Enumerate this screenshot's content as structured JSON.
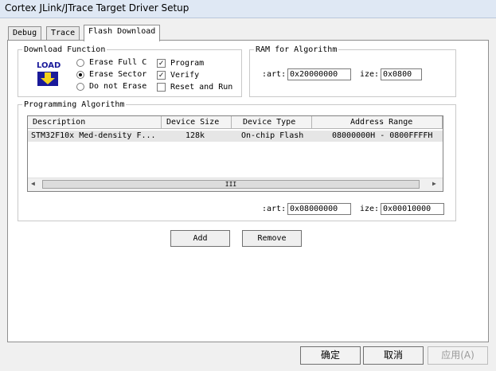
{
  "window": {
    "title": "Cortex JLink/JTrace Target Driver Setup"
  },
  "tabs": [
    {
      "label": "Debug"
    },
    {
      "label": "Trace"
    },
    {
      "label": "Flash Download"
    }
  ],
  "download_function": {
    "legend": "Download Function",
    "icon_text": "LOAD",
    "options": [
      {
        "label": "Erase Full C",
        "selected": false
      },
      {
        "label": "Erase Sector",
        "selected": true
      },
      {
        "label": "Do not Erase",
        "selected": false
      }
    ],
    "checks": [
      {
        "label": "Program",
        "checked": true
      },
      {
        "label": "Verify",
        "checked": true
      },
      {
        "label": "Reset and Run",
        "checked": false
      }
    ]
  },
  "ram": {
    "legend": "RAM for Algorithm",
    "start_label": ":art:",
    "start_value": "0x20000000",
    "size_label": "ize:",
    "size_value": "0x0800"
  },
  "programming": {
    "legend": "Programming Algorithm",
    "columns": [
      "Description",
      "Device Size",
      "Device Type",
      "Address Range"
    ],
    "rows": [
      {
        "description": "STM32F10x Med-density F...",
        "size": "128k",
        "type": "On-chip Flash",
        "range": "08000000H - 0800FFFFH"
      }
    ],
    "scroll_thumb_mark": "III",
    "start_label": ":art:",
    "start_value": "0x08000000",
    "size_label": "ize:",
    "size_value": "0x00010000"
  },
  "buttons": {
    "add": "Add",
    "remove": "Remove"
  },
  "footer": {
    "ok": "确定",
    "cancel": "取消",
    "apply": "应用(A)"
  }
}
